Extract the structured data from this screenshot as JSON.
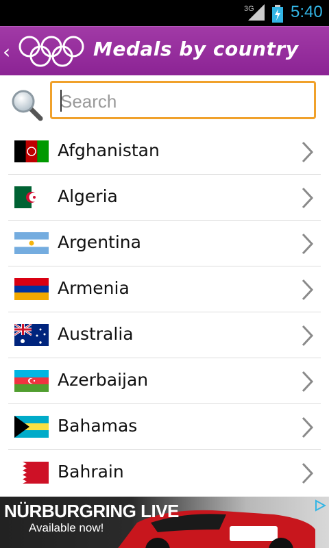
{
  "status": {
    "network": "3G",
    "time": "5:40"
  },
  "appbar": {
    "title": "Medals by country"
  },
  "search": {
    "placeholder": "Search",
    "value": ""
  },
  "countries": [
    {
      "name": "Afghanistan",
      "flag": "afghanistan-flag"
    },
    {
      "name": "Algeria",
      "flag": "algeria-flag"
    },
    {
      "name": "Argentina",
      "flag": "argentina-flag"
    },
    {
      "name": "Armenia",
      "flag": "armenia-flag"
    },
    {
      "name": "Australia",
      "flag": "australia-flag"
    },
    {
      "name": "Azerbaijan",
      "flag": "azerbaijan-flag"
    },
    {
      "name": "Bahamas",
      "flag": "bahamas-flag"
    },
    {
      "name": "Bahrain",
      "flag": "bahrain-flag"
    }
  ],
  "ad": {
    "headline": "NÜRBURGRING LIVE",
    "subline": "Available now!"
  },
  "colors": {
    "appbar": "#8b2394",
    "accent_orange": "#f0a12b",
    "clock": "#33b5e5"
  }
}
